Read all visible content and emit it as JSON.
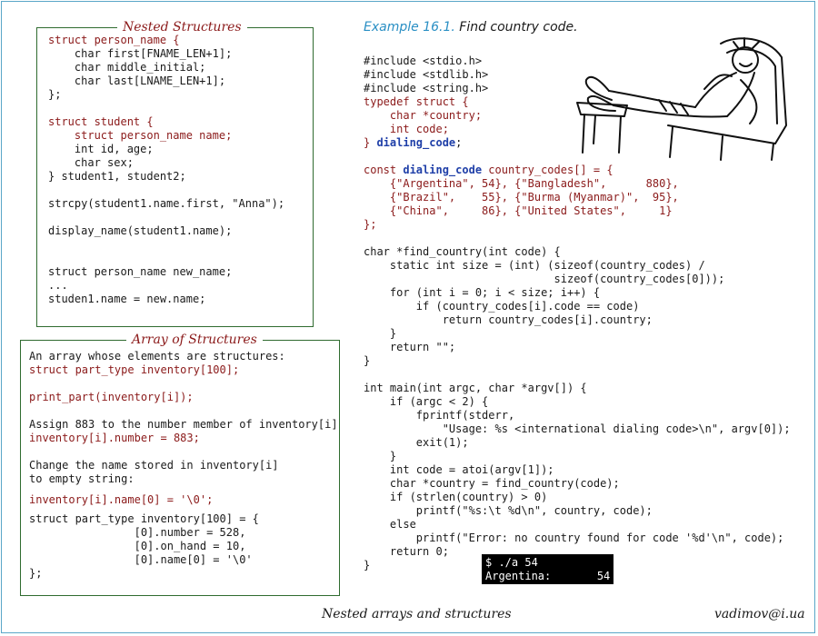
{
  "nested": {
    "title": "Nested Structures",
    "lines": [
      "struct person_name {",
      "    char first[FNAME_LEN+1];",
      "    char middle_initial;",
      "    char last[LNAME_LEN+1];",
      "};",
      "",
      "struct student {",
      "    struct person_name name;",
      "    int id, age;",
      "    char sex;",
      "} student1, student2;",
      "",
      "strcpy(student1.name.first, \"Anna\");",
      "",
      "display_name(student1.name);",
      "",
      "",
      "struct person_name new_name;",
      "...",
      "studen1.name = new.name;"
    ]
  },
  "array": {
    "title": "Array of Structures",
    "lines": [
      "An array whose elements are structures:",
      "struct part_type inventory[100];",
      "",
      "print_part(inventory[i]);",
      "",
      "Assign 883 to the number member of inventory[i]",
      "inventory[i].number = 883;",
      "",
      "Change the name stored in inventory[i]",
      "to empty string:",
      "inventory[i].name[0] = '\\0';",
      "struct part_type inventory[100] = {",
      "                [0].number = 528,",
      "                [0].on_hand = 10,",
      "                [0].name[0] = '\\0'",
      "};"
    ]
  },
  "example": {
    "number": "Example 16.1.",
    "title": "Find country code."
  },
  "code_lines": [
    "#include <stdio.h>",
    "#include <stdlib.h>",
    "#include <string.h>",
    "typedef struct {",
    "    char *country;",
    "    int code;",
    "} dialing_code;",
    "",
    "const dialing_code country_codes[] = {",
    "    {\"Argentina\", 54}, {\"Bangladesh\",      880},",
    "    {\"Brazil\",    55}, {\"Burma (Myanmar)\",  95},",
    "    {\"China\",     86}, {\"United States\",     1}",
    "};",
    "",
    "char *find_country(int code) {",
    "    static int size = (int) (sizeof(country_codes) /",
    "                             sizeof(country_codes[0]));",
    "    for (int i = 0; i < size; i++) {",
    "        if (country_codes[i].code == code)",
    "            return country_codes[i].country;",
    "    }",
    "    return \"\";",
    "}",
    "",
    "int main(int argc, char *argv[]) {",
    "    if (argc < 2) {",
    "        fprintf(stderr,",
    "            \"Usage: %s <international dialing code>\\n\", argv[0]);",
    "        exit(1);",
    "    }",
    "    int code = atoi(argv[1]);",
    "    char *country = find_country(code);",
    "    if (strlen(country) > 0)",
    "        printf(\"%s:\\t %d\\n\", country, code);",
    "    else",
    "        printf(\"Error: no country found for code '%d'\\n\", code);",
    "    return 0;",
    "}"
  ],
  "terminal": {
    "line1": "$ ./a 54",
    "line2": "Argentina:       54"
  },
  "footer": {
    "title": "Nested arrays and structures",
    "author": "vadimov@i.ua"
  }
}
